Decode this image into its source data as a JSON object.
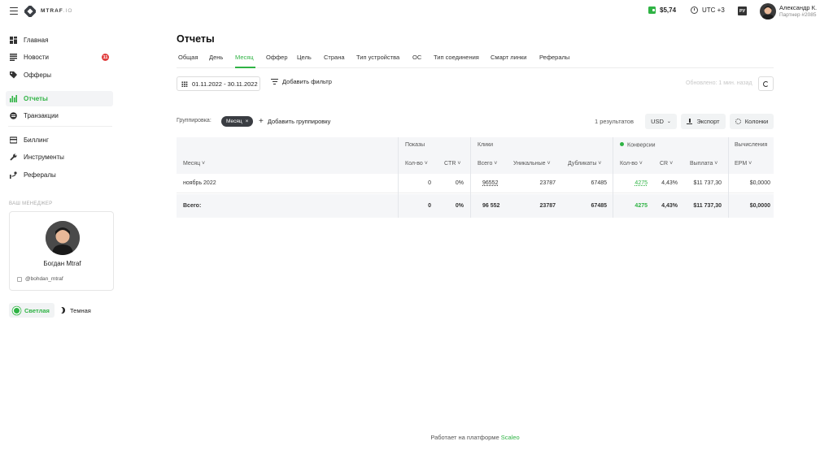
{
  "header": {
    "logo_text": "MTRAF",
    "logo_suffix": ".IO",
    "balance": "$5,74",
    "timezone": "UTC +3",
    "lang": "РУ",
    "user_name": "Александр К.",
    "user_sub": "Партнер #2085"
  },
  "sidebar": {
    "items": [
      {
        "label": "Главная",
        "icon": "dashboard-icon"
      },
      {
        "label": "Новости",
        "icon": "news-icon",
        "badge": "11"
      },
      {
        "label": "Офферы",
        "icon": "tag-icon"
      },
      {
        "label": "Отчеты",
        "icon": "bar-chart-icon",
        "active": true
      },
      {
        "label": "Транзакции",
        "icon": "transactions-icon"
      },
      {
        "label": "Биллинг",
        "icon": "billing-icon"
      },
      {
        "label": "Инструменты",
        "icon": "wrench-icon"
      },
      {
        "label": "Рефералы",
        "icon": "referrals-icon"
      }
    ],
    "manager_title": "ВАШ МЕНЕДЖЕР",
    "manager_name": "Богдан Mtraf",
    "manager_handle": "@bohdan_mtraf",
    "theme_light": "Светлая",
    "theme_dark": "Темная"
  },
  "main": {
    "title": "Отчеты",
    "tabs": [
      "Общая",
      "День",
      "Месяц",
      "Оффер",
      "Цель",
      "Страна",
      "Тип устройства",
      "ОС",
      "Тип соединения",
      "Смарт линки",
      "Рефералы"
    ],
    "active_tab": "Месяц",
    "date_range": "01.11.2022 - 30.11.2022",
    "add_filter": "Добавить фильтр",
    "updated": "Обновлено: 1 мин. назад",
    "group_label": "Группировка:",
    "group_chip": "Месяц",
    "add_group": "Добавить группировку",
    "results": "1 результатов",
    "currency": "USD",
    "export": "Экспорт",
    "columns": "Колонки"
  },
  "table": {
    "groups": {
      "shows": "Показы",
      "clicks": "Клики",
      "conversions": "Конверсии",
      "calc": "Вычисления"
    },
    "headers": {
      "month": "Месяц",
      "shows_count": "Кол-во",
      "ctr": "CTR",
      "clicks_total": "Всего",
      "unique": "Уникальные",
      "duplicates": "Дубликаты",
      "conv_count": "Кол-во",
      "cr": "CR",
      "payout": "Выплата",
      "epm": "EPM"
    },
    "row": {
      "month": "ноябрь 2022",
      "shows_count": "0",
      "ctr": "0%",
      "clicks_total": "96552",
      "unique": "23787",
      "duplicates": "67485",
      "conv_count": "4275",
      "cr": "4,43%",
      "payout": "$11 737,30",
      "epm": "$0,0000"
    },
    "total": {
      "label": "Всего:",
      "shows_count": "0",
      "ctr": "0%",
      "clicks_total": "96 552",
      "unique": "23787",
      "duplicates": "67485",
      "conv_count": "4275",
      "cr": "4,43%",
      "payout": "$11 737,30",
      "epm": "$0,0000"
    }
  },
  "footer": {
    "text": "Работает на платформе",
    "link": "Scaleo"
  },
  "colors": {
    "accent": "#2fb344",
    "badge": "#e03c3c",
    "chip": "#3a3d42"
  }
}
